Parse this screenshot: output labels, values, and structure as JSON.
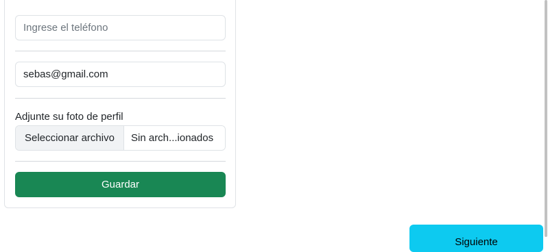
{
  "form": {
    "phone": {
      "value": "",
      "placeholder": "Ingrese el teléfono"
    },
    "email": {
      "value": "sebas@gmail.com",
      "placeholder": ""
    },
    "photo": {
      "label": "Adjunte su foto de perfil",
      "button_label": "Seleccionar archivo",
      "file_status": "Sin arch...ionados"
    },
    "save_label": "Guardar"
  },
  "footer": {
    "next_label": "Siguiente"
  },
  "colors": {
    "save_button": "#198754",
    "next_button": "#0dcaf0"
  }
}
